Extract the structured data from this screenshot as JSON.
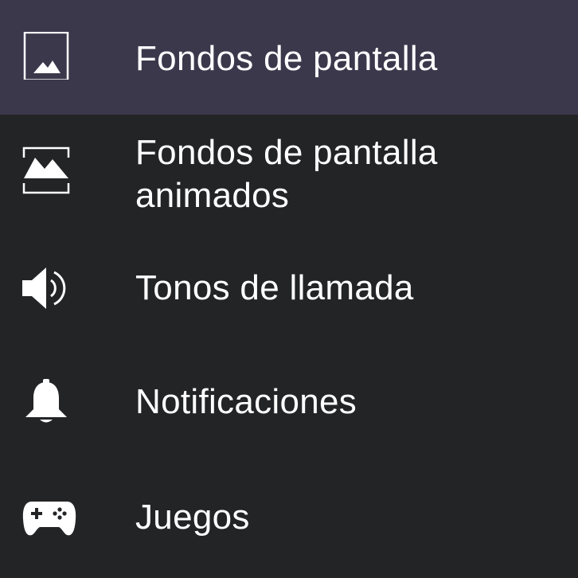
{
  "menu": {
    "items": [
      {
        "label": "Fondos de pantalla",
        "icon": "image-icon",
        "selected": true
      },
      {
        "label_line1": "Fondos de pantalla",
        "label_line2": "animados",
        "icon": "live-wallpaper-icon",
        "selected": false
      },
      {
        "label": "Tonos de llamada",
        "icon": "speaker-icon",
        "selected": false
      },
      {
        "label": "Notificaciones",
        "icon": "bell-icon",
        "selected": false
      },
      {
        "label": "Juegos",
        "icon": "gamepad-icon",
        "selected": false
      }
    ]
  },
  "colors": {
    "background": "#232426",
    "selected_background": "#3b384c",
    "text": "#ffffff"
  }
}
